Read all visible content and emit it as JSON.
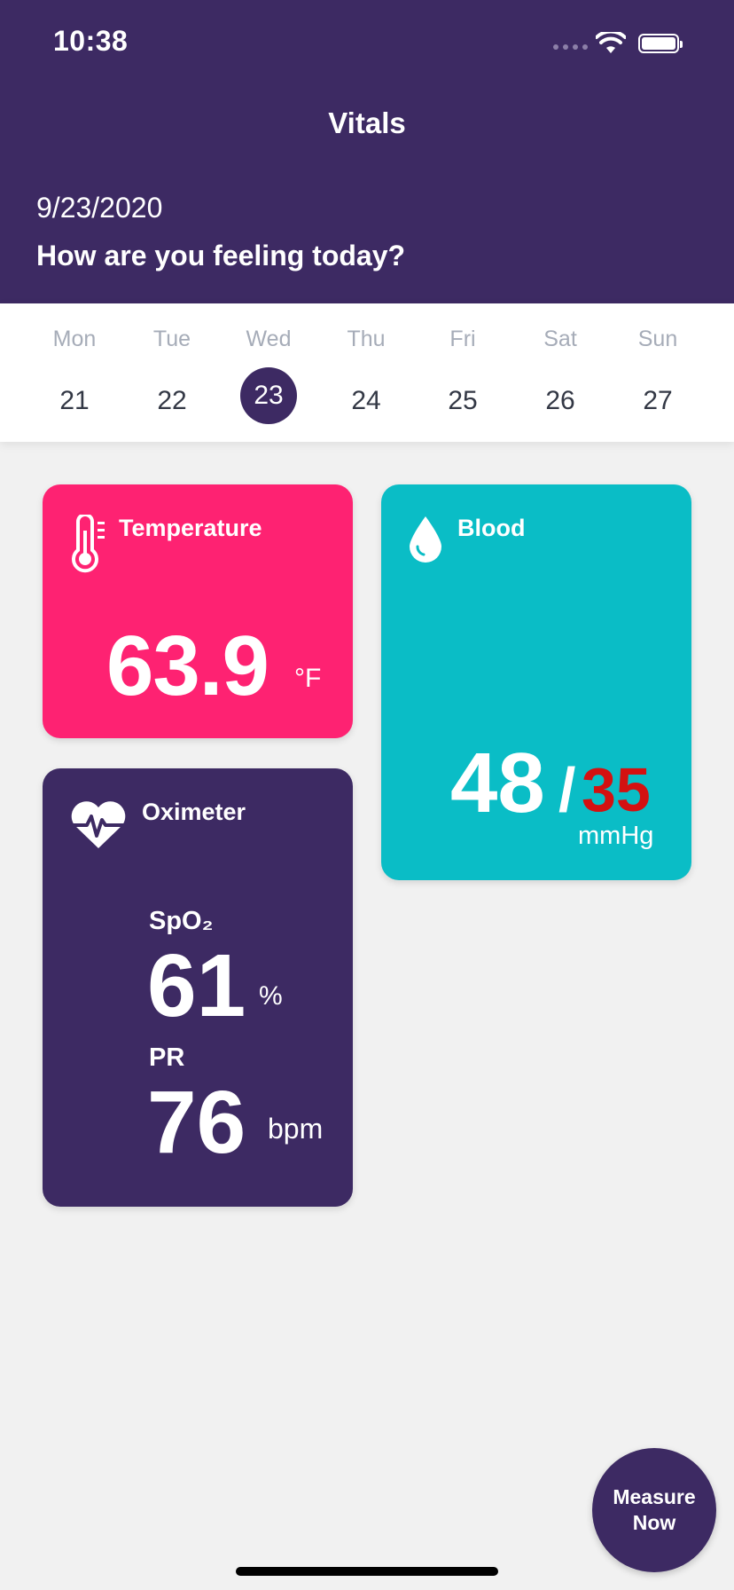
{
  "status_bar": {
    "time": "10:38"
  },
  "header": {
    "title": "Vitals",
    "date": "9/23/2020",
    "greeting": "How are you feeling today?"
  },
  "week": {
    "days": [
      {
        "name": "Mon",
        "num": "21"
      },
      {
        "name": "Tue",
        "num": "22"
      },
      {
        "name": "Wed",
        "num": "23"
      },
      {
        "name": "Thu",
        "num": "24"
      },
      {
        "name": "Fri",
        "num": "25"
      },
      {
        "name": "Sat",
        "num": "26"
      },
      {
        "name": "Sun",
        "num": "27"
      }
    ],
    "selected_day": "23"
  },
  "cards": {
    "temperature": {
      "title": "Temperature",
      "value": "63.9",
      "unit": "°F",
      "icon": "thermometer-icon",
      "color": "#fe2272"
    },
    "blood": {
      "title": "Blood",
      "systolic": "48",
      "separator": "/",
      "diastolic": "35",
      "unit": "mmHg",
      "icon": "blood-drop-icon",
      "color": "#0abdc6",
      "diastolic_color": "#d41111"
    },
    "oximeter": {
      "title": "Oximeter",
      "icon": "heart-pulse-icon",
      "color": "#3d2a63",
      "spo2_label": "SpO₂",
      "spo2_value": "61",
      "spo2_unit": "%",
      "pr_label": "PR",
      "pr_value": "76",
      "pr_unit": "bpm"
    }
  },
  "fab": {
    "line1": "Measure",
    "line2": "Now"
  },
  "colors": {
    "primary": "#3d2a63",
    "background": "#f1f1f1"
  }
}
